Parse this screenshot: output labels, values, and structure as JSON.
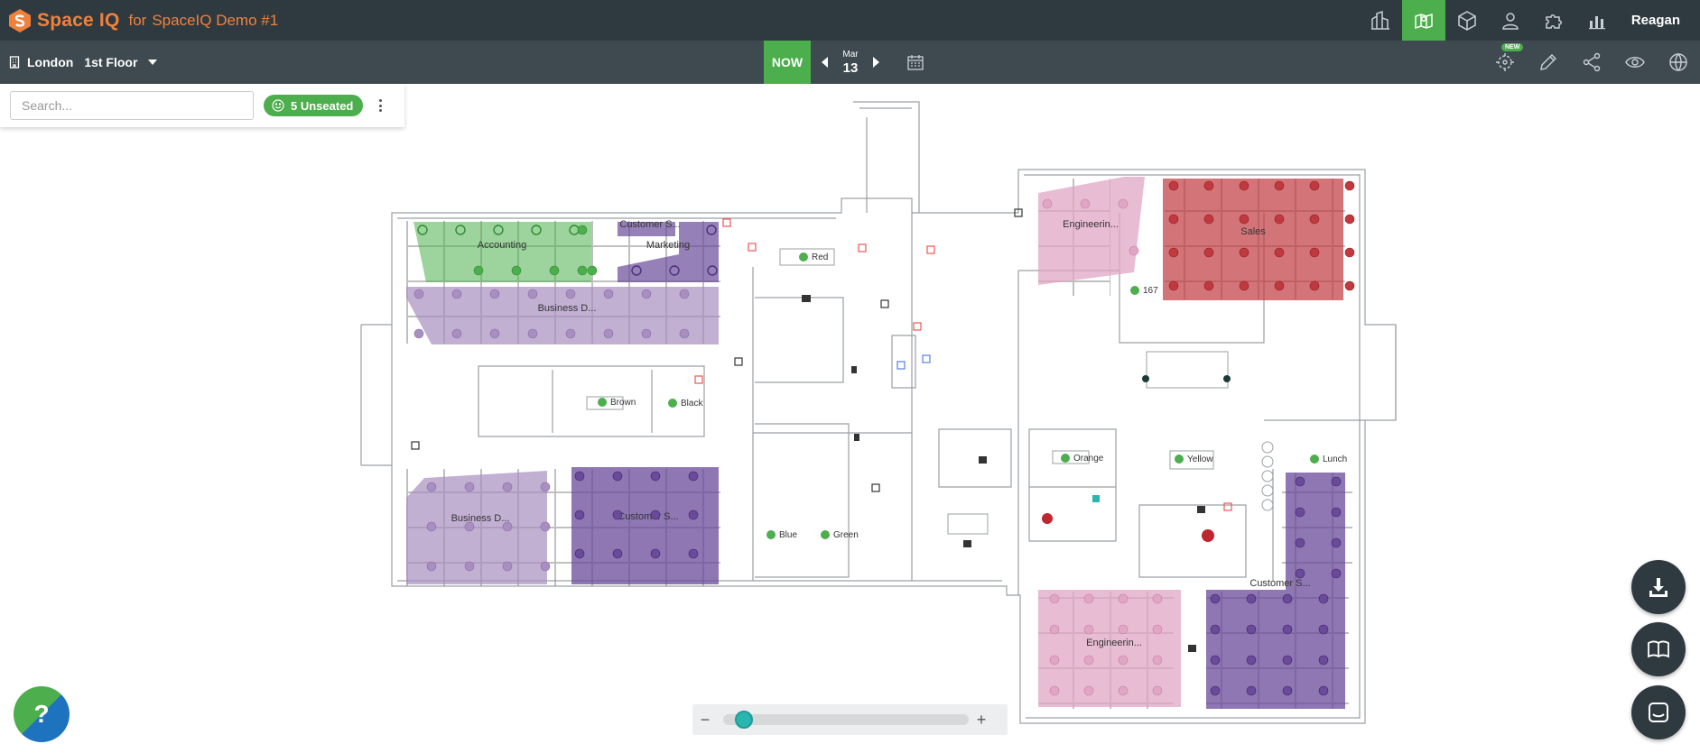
{
  "header": {
    "brand_name": "Space IQ",
    "brand_for": "for",
    "org_name": "SpaceIQ Demo #1",
    "user_name": "Reagan",
    "nav_icons": [
      "buildings-icon",
      "floor-map-icon",
      "cube-icon",
      "person-icon",
      "puzzle-icon",
      "bar-chart-icon"
    ],
    "accent_color": "#f0813b",
    "active_color": "#4cae4c"
  },
  "subbar": {
    "building": "London",
    "floor": "1st Floor",
    "now_label": "NOW",
    "month": "Mar",
    "day": "13",
    "new_badge": "NEW"
  },
  "search": {
    "placeholder": "Search...",
    "unseated_label": "5 Unseated"
  },
  "floorplan": {
    "zones": {
      "accounting": "Accounting",
      "customer_s_top": "Customer S...",
      "marketing": "Marketing",
      "business_d_top": "Business D...",
      "business_d_bottom": "Business D...",
      "customer_s_bottom": "Customer S...",
      "engineering_top": "Engineerin...",
      "sales": "Sales",
      "engineering_bottom": "Engineerin...",
      "customer_s_right": "Customer S..."
    },
    "rooms": {
      "red": "Red",
      "brown": "Brown",
      "black": "Black",
      "blue": "Blue",
      "green": "Green",
      "orange": "Orange",
      "yellow": "Yellow",
      "lunch": "Lunch",
      "room_167": "167"
    },
    "colors": {
      "green_zone": "#4cae4c",
      "purple_light": "#a88fc0",
      "purple_dark": "#6a4a9a",
      "pink": "#e0a6c4",
      "red": "#c0393f"
    }
  },
  "zoom": {
    "minus": "−",
    "plus": "+",
    "level": 0.05
  },
  "help_label": "?"
}
